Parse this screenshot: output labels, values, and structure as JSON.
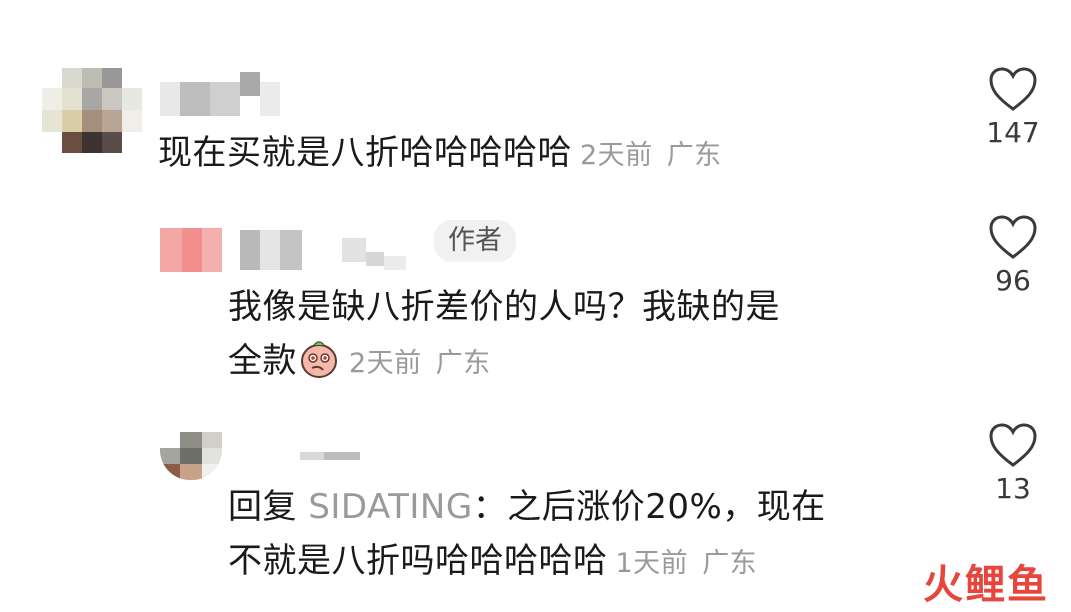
{
  "comments": [
    {
      "text": "现在买就是八折哈哈哈哈哈",
      "time": "2天前",
      "location": "广东",
      "likes": "147"
    },
    {
      "badge": "作者",
      "text_line1": "我像是缺八折差价的人吗？我缺的是",
      "text_line2": "全款",
      "time": "2天前",
      "location": "广东",
      "likes": "96"
    },
    {
      "reply_prefix": "回复",
      "reply_target": "SIDATING",
      "text_line1_rest": "：之后涨价20%，现在",
      "text_line2": "不就是八折吗哈哈哈哈哈",
      "time": "1天前",
      "location": "广东",
      "likes": "13"
    }
  ],
  "watermark": "火鲤鱼",
  "colors": {
    "meta": "#9a9a9a",
    "text": "#1a1a1a",
    "watermark": "#e8463c"
  },
  "icons": [
    "heart-icon",
    "emoji-icon"
  ]
}
